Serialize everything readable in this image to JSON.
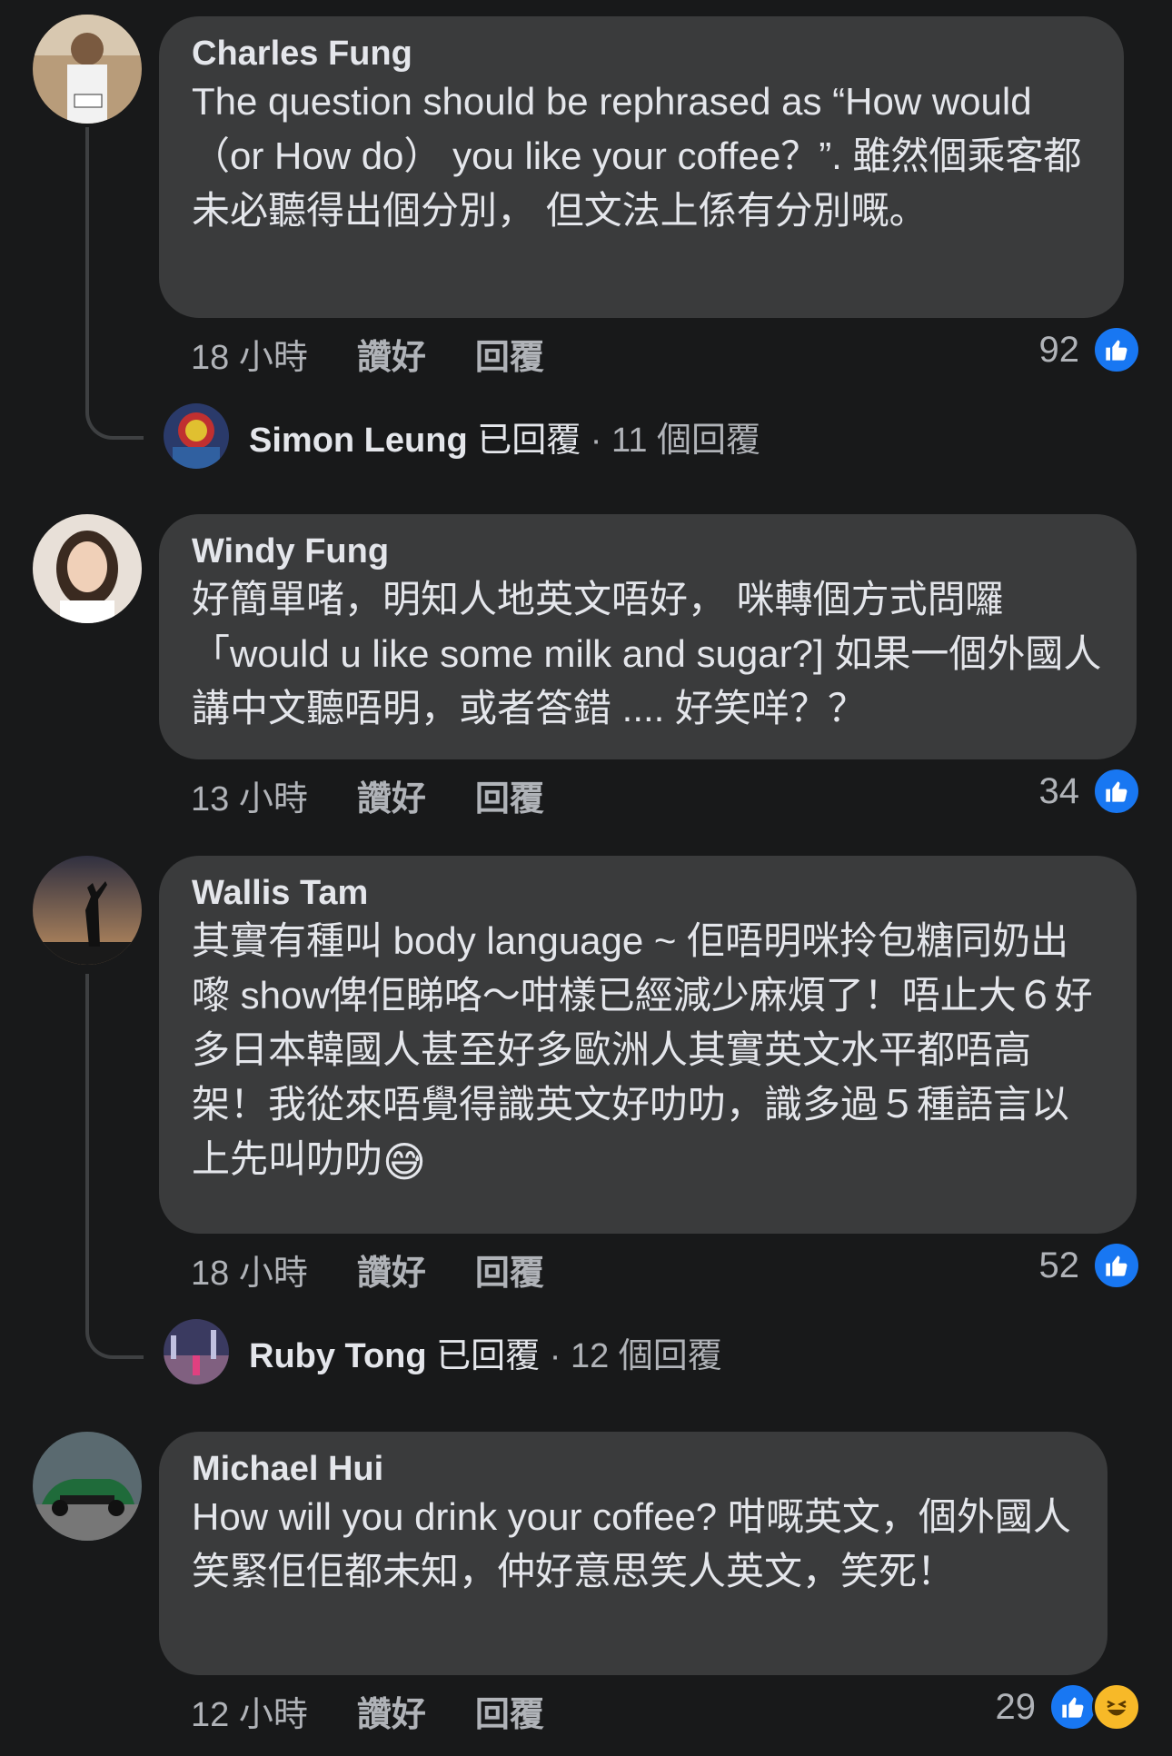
{
  "comments": [
    {
      "author": "Charles Fung",
      "text": "The question should be rephrased as “How would （or How do） you like your coffee？”. 雖然個乘客都未必聽得出個分別， 但文法上係有分別嘅。",
      "time": "18 小時",
      "like_label": "讚好",
      "reply_label": "回覆",
      "likes": "92",
      "reply": {
        "name": "Simon Leung",
        "action": "已回覆",
        "sep": "·",
        "count": "11 個回覆"
      }
    },
    {
      "author": "Windy Fung",
      "text": "好簡單啫，明知人地英文唔好， 咪轉個方式問囉「would u like some milk and sugar?] 如果一個外國人講中文聽唔明，或者答錯 .... 好笑咩？？",
      "time": "13 小時",
      "like_label": "讚好",
      "reply_label": "回覆",
      "likes": "34"
    },
    {
      "author": "Wallis Tam",
      "text": "其實有種叫 body language ~ 佢唔明咪拎包糖同奶出嚟 show俾佢睇咯～咁樣已經減少麻煩了！唔止大６好多日本韓國人甚至好多歐洲人其實英文水平都唔高架！我從來唔覺得識英文好叻叻，識多過５種語言以上先叫叻叻",
      "emoji": "😅",
      "time": "18 小時",
      "like_label": "讚好",
      "reply_label": "回覆",
      "likes": "52",
      "reply": {
        "name": "Ruby Tong",
        "action": "已回覆",
        "sep": "·",
        "count": "12 個回覆"
      }
    },
    {
      "author": "Michael Hui",
      "text": "How will you drink your coffee? 咁嘅英文，個外國人笑緊佢佢都未知，仲好意思笑人英文，笑死！",
      "time": "12 小時",
      "like_label": "讚好",
      "reply_label": "回覆",
      "likes": "29"
    }
  ]
}
